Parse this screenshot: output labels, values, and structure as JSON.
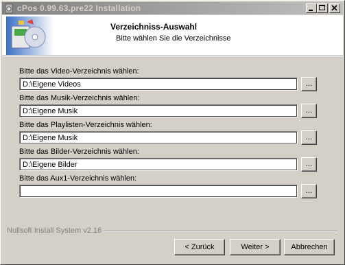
{
  "window": {
    "title": "cPos 0.99.63.pre22 Installation"
  },
  "header": {
    "title": "Verzeichniss-Auswahl",
    "subtitle": "Bitte wählen Sie die Verzeichnisse"
  },
  "fields": [
    {
      "label": "Bitte das Video-Verzeichnis wählen:",
      "value": "D:\\Eigene Videos"
    },
    {
      "label": "Bitte das Musik-Verzeichnis wählen:",
      "value": "D:\\Eigene Musik"
    },
    {
      "label": "Bitte das Playlisten-Verzeichnis wählen:",
      "value": "D:\\Eigene Musik"
    },
    {
      "label": "Bitte das Bilder-Verzeichnis wählen:",
      "value": "D:\\Eigene Bilder"
    },
    {
      "label": "Bitte das Aux1-Verzeichnis wählen:",
      "value": ""
    }
  ],
  "browse_label": "...",
  "footer": {
    "brand": "Nullsoft Install System v2.16",
    "back": "< Zurück",
    "next": "Weiter >",
    "cancel": "Abbrechen"
  }
}
